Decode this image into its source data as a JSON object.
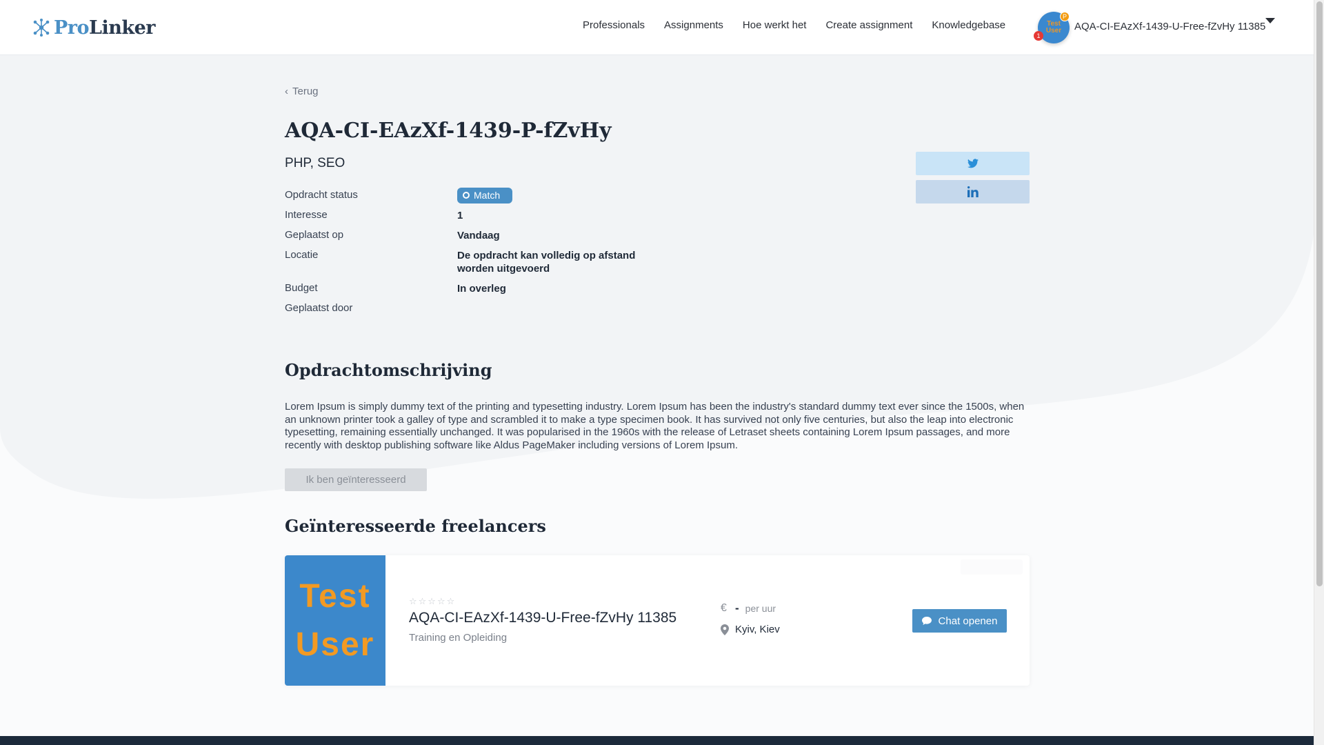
{
  "brand": {
    "pro": "Pro",
    "linker": "Linker"
  },
  "nav": [
    {
      "label": "Professionals"
    },
    {
      "label": "Assignments"
    },
    {
      "label": "Hoe werkt het"
    },
    {
      "label": "Create assignment"
    },
    {
      "label": "Knowledgebase"
    }
  ],
  "user": {
    "name": "AQA-CI-EAzXf-1439-U-Free-fZvHy 11385",
    "avatar_line1": "Test",
    "avatar_line2": "User",
    "notification_count": "1",
    "plan_badge": "P"
  },
  "back_label": "Terug",
  "assignment": {
    "title": "AQA-CI-EAzXf-1439-P-fZvHy",
    "skills": "PHP, SEO",
    "details": [
      {
        "label": "Opdracht status",
        "value": "Match"
      },
      {
        "label": "Interesse",
        "value": "1"
      },
      {
        "label": "Geplaatst op",
        "value": "Vandaag"
      },
      {
        "label": "Locatie",
        "value": "De opdracht kan volledig op afstand worden uitgevoerd"
      },
      {
        "label": "Budget",
        "value": "In overleg"
      },
      {
        "label": "Geplaatst door",
        "value": ""
      }
    ],
    "description_heading": "Opdrachtomschrijving",
    "description": "Lorem Ipsum is simply dummy text of the printing and typesetting industry. Lorem Ipsum has been the industry's standard dummy text ever since the 1500s, when an unknown printer took a galley of type and scrambled it to make a type specimen book. It has survived not only five centuries, but also the leap into electronic typesetting, remaining essentially unchanged. It was popularised in the 1960s with the release of Letraset sheets containing Lorem Ipsum passages, and more recently with desktop publishing software like Aldus PageMaker including versions of Lorem Ipsum.",
    "interest_button": "Ik ben geïnteresseerd"
  },
  "share": {
    "twitter_icon": "twitter-icon",
    "linkedin_icon": "linkedin-icon"
  },
  "freelancers": {
    "heading": "Geïnteresseerde freelancers",
    "items": [
      {
        "image_line1": "Test",
        "image_line2": "User",
        "rating_stars": "☆☆☆☆☆",
        "name": "AQA-CI-EAzXf-1439-U-Free-fZvHy 11385",
        "category": "Training en Opleiding",
        "rate_value": "-",
        "rate_unit": "per uur",
        "location": "Kyiv, Kiev",
        "chat_label": "Chat openen"
      }
    ]
  },
  "colors": {
    "accent": "#4a90c6",
    "status_match": "#4a90c6",
    "disabled_button": "#d7dade",
    "footer": "#1c2a3b"
  }
}
